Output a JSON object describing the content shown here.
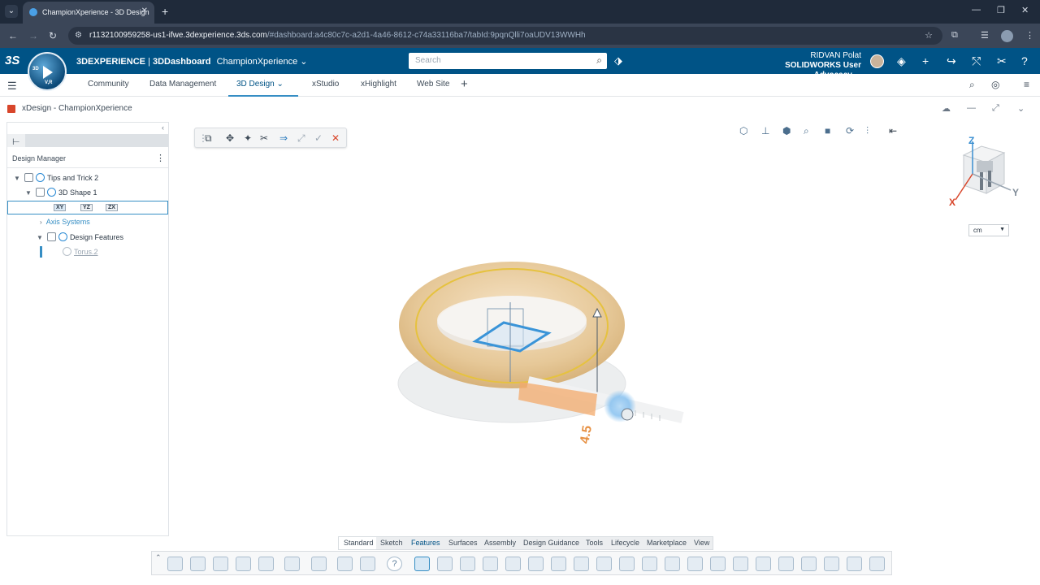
{
  "browser": {
    "tab_title": "ChampionXperience - 3D Design",
    "tab_close": "✕",
    "new_tab": "+",
    "url_host": "r1132100959258-us1-ifwe.3dexperience.3ds.com",
    "url_rest": "/#dashboard:a4c80c7c-a2d1-4a46-8612-c74a33116ba7/tabId:9pqnQlli7oaUDV13WWHh"
  },
  "app": {
    "logo": "3S",
    "brand_bold": "3DEXPERIENCE",
    "brand_sep": " | ",
    "brand_app": "3DDashboard",
    "dashboard_name": "ChampionXperience ⌄",
    "search_placeholder": "Search",
    "user_name": "RIDVAN Polat",
    "user_role": "SOLIDWORKS User Advocacy ⌄",
    "compass_top": "3D",
    "compass_bottom": "V,R"
  },
  "dashboard_tabs": {
    "items": [
      "Community",
      "Data Management",
      "3D Design  ⌄",
      "xStudio",
      "xHighlight",
      "Web Site"
    ],
    "active": "3D Design"
  },
  "widget": {
    "title": "xDesign - ChampionXperience"
  },
  "design_manager": {
    "title": "Design Manager",
    "tree": {
      "root": "Tips and Trick 2",
      "shape": "3D Shape 1",
      "planes": [
        "XY",
        "YZ",
        "ZX"
      ],
      "axis_systems": "Axis Systems",
      "design_features": "Design Features",
      "feature": "Torus.2"
    }
  },
  "viewport": {
    "unit": "cm",
    "dimension_value": "4.5",
    "axis_labels": {
      "x": "X",
      "y": "Y",
      "z": "Z"
    }
  },
  "action_tabs": {
    "items": [
      "Standard",
      "Sketch",
      "Features",
      "Surfaces",
      "Assembly",
      "Design Guidance",
      "Tools",
      "Lifecycle",
      "Marketplace",
      "View"
    ],
    "active": "Features"
  },
  "colors": {
    "header_blue": "#005386",
    "accent": "#368ec4",
    "torus_fill": "#e9cda2",
    "dimension_orange": "#e79144"
  }
}
